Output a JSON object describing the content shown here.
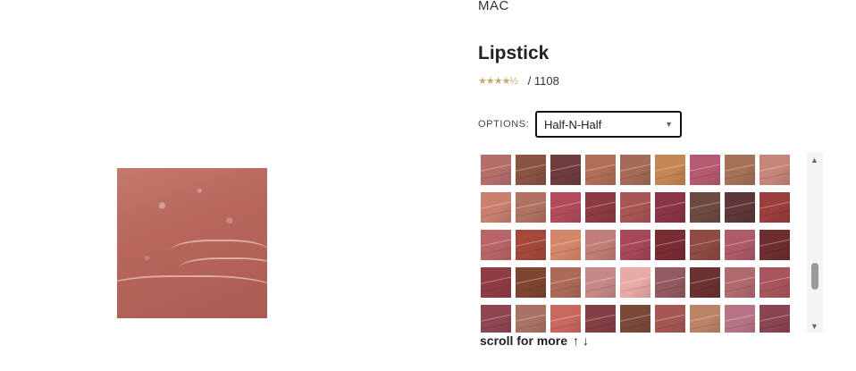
{
  "product": {
    "brand": "MAC",
    "title": "Lipstick",
    "rating_stars": "★★★★½",
    "review_count": "/ 1108"
  },
  "options": {
    "label": "OPTIONS:",
    "selected": "Half-N-Half"
  },
  "swatches": [
    "#b66e6b",
    "#8a5342",
    "#6f3c3e",
    "#b06e57",
    "#a46b58",
    "#c48652",
    "#b65a71",
    "#a47256",
    "#c7867a",
    "#c9806f",
    "#b07363",
    "#b24b5a",
    "#8d3b42",
    "#a85555",
    "#893545",
    "#6c4a41",
    "#5e3839",
    "#9a3e3e",
    "#b96467",
    "#a4493a",
    "#d6866a",
    "#c17d77",
    "#a74757",
    "#7a2c33",
    "#8f4a44",
    "#ae5a68",
    "#6e2e2f",
    "#8f3d45",
    "#7e4631",
    "#ae6a58",
    "#c68987",
    "#e8aaa6",
    "#935a62",
    "#6c3232",
    "#b16a6f",
    "#a9555d",
    "#8e4752",
    "#aa7264",
    "#c9685e",
    "#843f45",
    "#7a4a39",
    "#a65755",
    "#bb8467",
    "#b77485",
    "#8a4552"
  ],
  "scroll_hint": {
    "text": "scroll for more",
    "arrows": "↑ ↓"
  }
}
